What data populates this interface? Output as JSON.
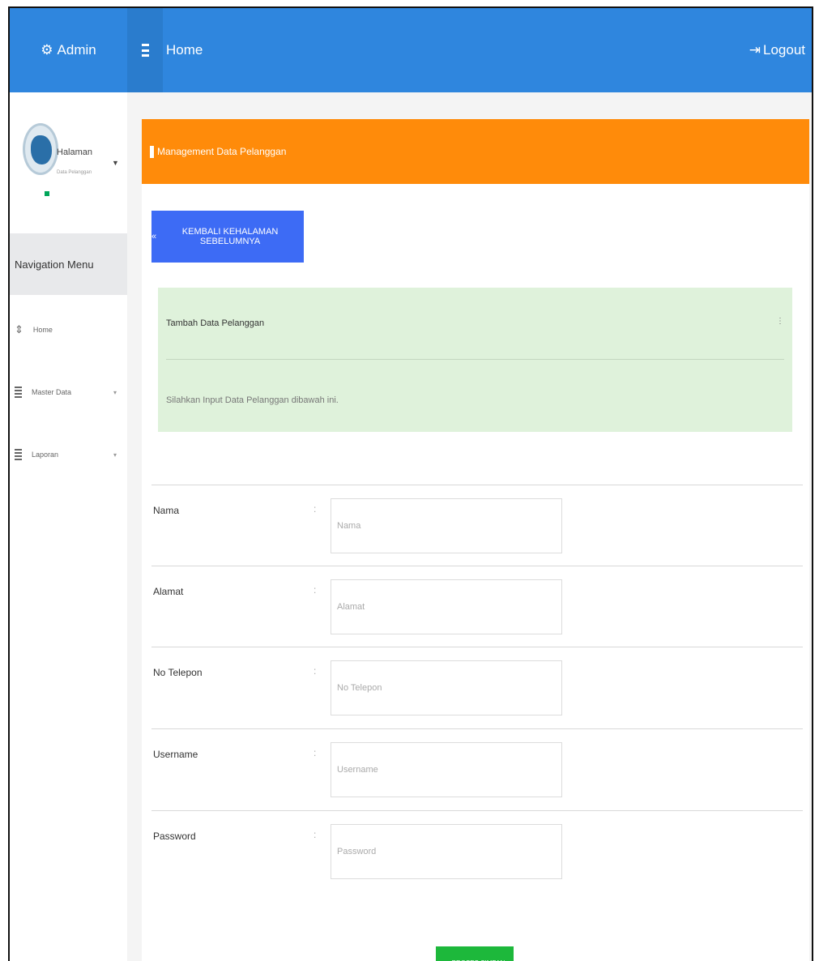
{
  "topbar": {
    "brand": "Admin",
    "brand_icon": "gear-icon",
    "title": "Home",
    "logout": "Logout"
  },
  "sidebar": {
    "user": {
      "name": "Halaman",
      "role": "Data Pelanggan"
    },
    "header": "Navigation Menu",
    "items": [
      {
        "label": "Home",
        "icon": "home-icon"
      },
      {
        "label": "Master Data",
        "icon": "list-icon"
      },
      {
        "label": "Laporan",
        "icon": "list-icon"
      }
    ]
  },
  "box": {
    "header": "Management Data Pelanggan",
    "back_button": "KEMBALI KEHALAMAN SEBELUMNYA",
    "back_icon": "«",
    "callout": {
      "title": "Tambah Data Pelanggan",
      "text": "Silahkan Input Data Pelanggan dibawah ini."
    }
  },
  "form": {
    "fields": [
      {
        "label": "Nama",
        "placeholder": "Nama"
      },
      {
        "label": "Alamat",
        "placeholder": "Alamat"
      },
      {
        "label": "No Telepon",
        "placeholder": "No Telepon"
      },
      {
        "label": "Username",
        "placeholder": "Username"
      },
      {
        "label": "Password",
        "placeholder": "Password"
      }
    ],
    "separator": ":",
    "submit": "✔ PROSES SIMPAN DATA"
  },
  "colors": {
    "topbar": "#2f86de",
    "header": "#ff8b0a",
    "back_button": "#3d6bf5",
    "callout": "#dff2db",
    "save_button": "#1db83b"
  }
}
